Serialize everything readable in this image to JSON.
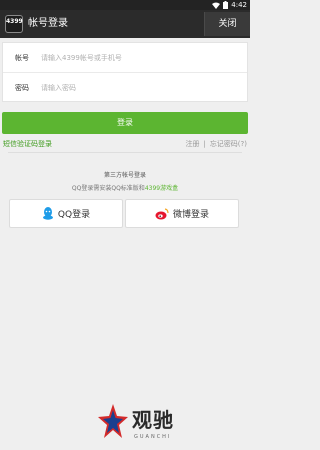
{
  "status_bar": {
    "time": "4:42",
    "icons": [
      "wifi-icon",
      "battery-icon"
    ]
  },
  "app_bar": {
    "logo_text": "4399",
    "title": "帐号登录",
    "close_label": "关闭"
  },
  "form": {
    "account_label": "帐号",
    "account_placeholder": "请输入4399帐号或手机号",
    "account_value": "",
    "password_label": "密码",
    "password_placeholder": "请输入密码",
    "password_value": ""
  },
  "login_button": "登录",
  "links": {
    "sms_login": "短信验证码登录",
    "register": "注册",
    "separator": "|",
    "forgot": "忘记密码(?)"
  },
  "third_party": {
    "title": "第三方帐号登录",
    "tip_prefix": "QQ登录需安装QQ标准版和",
    "tip_highlight": "4399游戏盒",
    "qq_label": "QQ登录",
    "weibo_label": "微博登录"
  },
  "watermark": {
    "text": "观驰",
    "sub": "GUANCHI"
  },
  "colors": {
    "accent_green": "#5cb531",
    "appbar": "#2b2b2b",
    "qq_blue": "#1e9ce8",
    "weibo_red": "#e6162d"
  }
}
